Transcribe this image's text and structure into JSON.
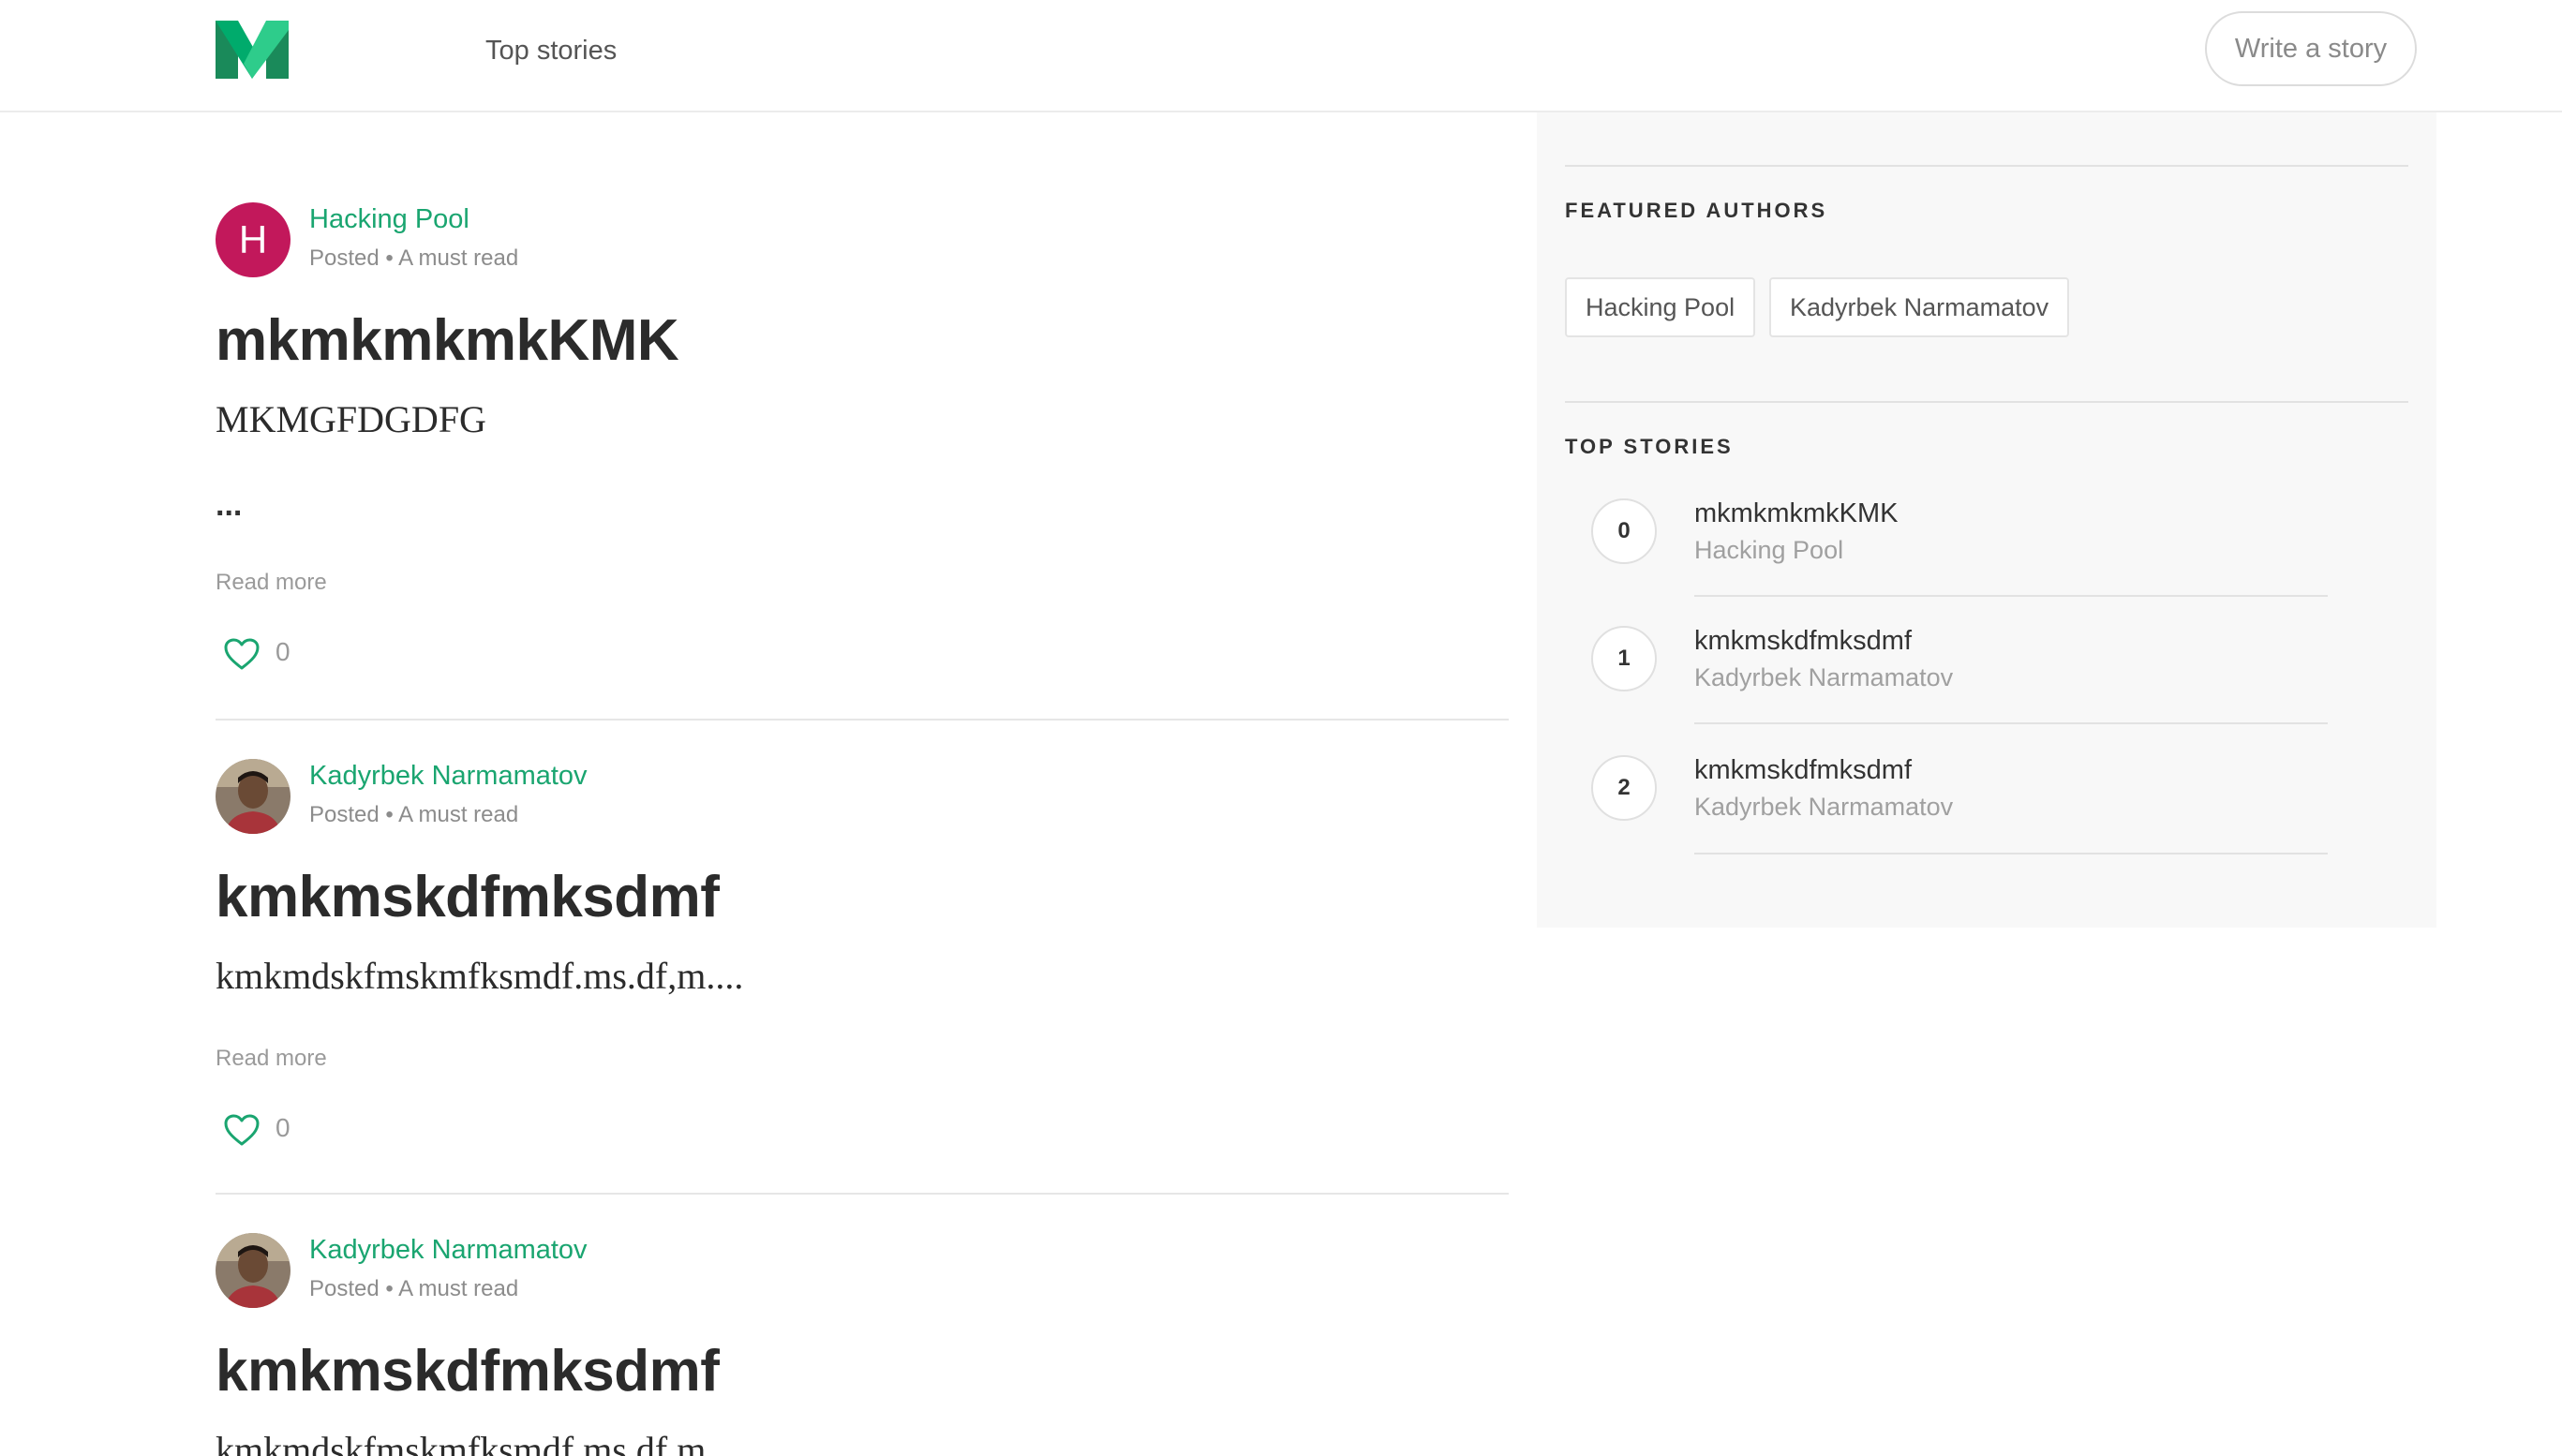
{
  "header": {
    "nav_label": "Top stories",
    "write_button": "Write a story",
    "logo_icon": "medium-m-logo-icon",
    "brand_colors": {
      "green_light": "#00ab6c",
      "green_dark": "#1a8a5a"
    }
  },
  "posts": [
    {
      "author": "Hacking Pool",
      "avatar_letter": "H",
      "meta": "Posted • A must read",
      "title": "mkmkmkmkKMK",
      "excerpt": "MKMGFDGDFG",
      "extra": "...",
      "read_more": "Read more",
      "likes": "0"
    },
    {
      "author": "Kadyrbek Narmamatov",
      "meta": "Posted • A must read",
      "title": "kmkmskdfmksdmf",
      "excerpt": "kmkmdskfmskmfksmdf.ms.df,m....",
      "read_more": "Read more",
      "likes": "0"
    },
    {
      "author": "Kadyrbek Narmamatov",
      "meta": "Posted • A must read",
      "title": "kmkmskdfmksdmf",
      "excerpt": "kmkmdskfmskmfksmdf.ms.df,m...."
    }
  ],
  "sidebar": {
    "featured_heading": "FEATURED AUTHORS",
    "featured_authors": [
      "Hacking Pool",
      "Kadyrbek Narmamatov"
    ],
    "top_heading": "TOP STORIES",
    "top_stories": [
      {
        "rank": "0",
        "title": "mkmkmkmkKMK",
        "author": "Hacking Pool"
      },
      {
        "rank": "1",
        "title": "kmkmskdfmksdmf",
        "author": "Kadyrbek Narmamatov"
      },
      {
        "rank": "2",
        "title": "kmkmskdfmksdmf",
        "author": "Kadyrbek Narmamatov"
      }
    ]
  },
  "colors": {
    "accent_green": "#1aa570",
    "avatar_magenta": "#c2185b",
    "sidebar_bg": "#f8f8f8"
  }
}
